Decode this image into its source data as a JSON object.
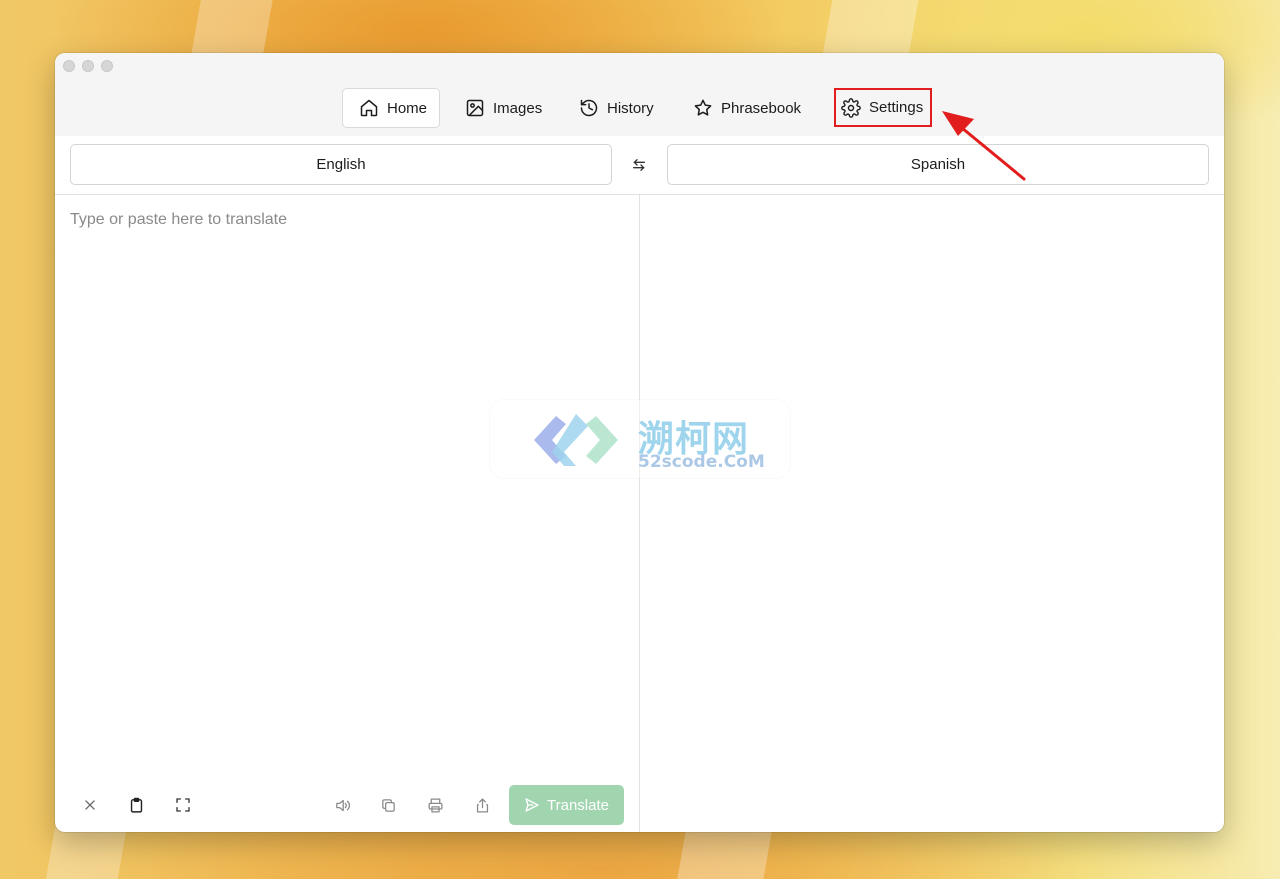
{
  "nav": {
    "tabs": [
      {
        "label": "Home",
        "icon": "home-icon",
        "active": true
      },
      {
        "label": "Images",
        "icon": "image-icon",
        "active": false
      },
      {
        "label": "History",
        "icon": "history-icon",
        "active": false
      },
      {
        "label": "Phrasebook",
        "icon": "star-icon",
        "active": false
      },
      {
        "label": "Settings",
        "icon": "gear-icon",
        "active": false,
        "highlighted": true
      }
    ]
  },
  "languages": {
    "source": "English",
    "target": "Spanish",
    "swap_icon": "swap-arrows-icon"
  },
  "source_input": {
    "placeholder": "Type or paste here to translate",
    "value": ""
  },
  "toolbar": {
    "left_icons": [
      "close-icon",
      "clipboard-icon",
      "expand-icon"
    ],
    "right_icons": [
      "speaker-icon",
      "copy-icon",
      "print-icon",
      "share-icon"
    ],
    "translate_label": "Translate",
    "translate_icon": "send-icon",
    "translate_color": "#a1d5b0"
  },
  "watermark": {
    "title": "溯柯网",
    "subtitle": "52scode.CoM"
  },
  "annotation": {
    "highlight_color": "#e21d1d",
    "arrow_color": "#e21d1d"
  }
}
